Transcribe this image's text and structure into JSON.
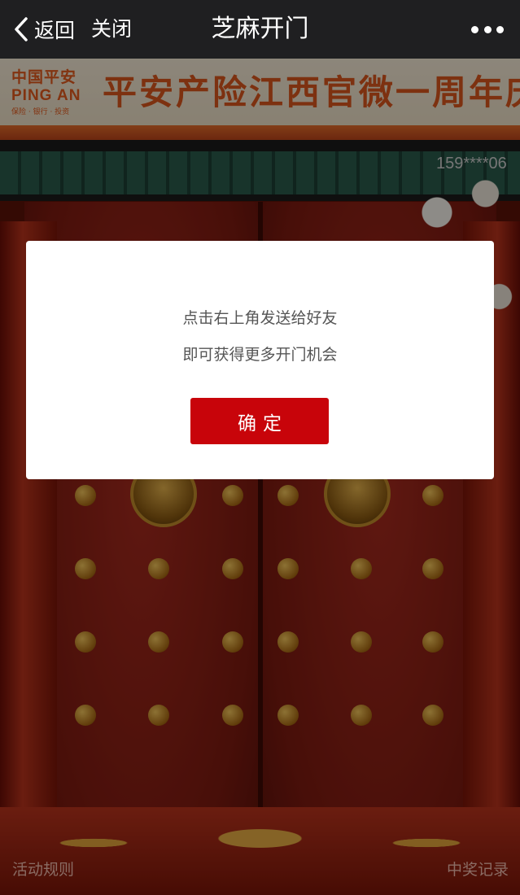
{
  "navbar": {
    "back_label": "返回",
    "close_label": "关闭",
    "title": "芝麻开门"
  },
  "banner": {
    "logo_cn": "中国平安",
    "logo_en": "PING AN",
    "logo_tagline": "保险 · 银行 · 投资",
    "slogan": "平安产险江西官微一周年庆"
  },
  "scene": {
    "phone_masked": "159****06"
  },
  "dialog": {
    "line1": "点击右上角发送给好友",
    "line2": "即可获得更多开门机会",
    "confirm_label": "确定"
  },
  "footer": {
    "rules_label": "活动规则",
    "records_label": "中奖记录"
  }
}
